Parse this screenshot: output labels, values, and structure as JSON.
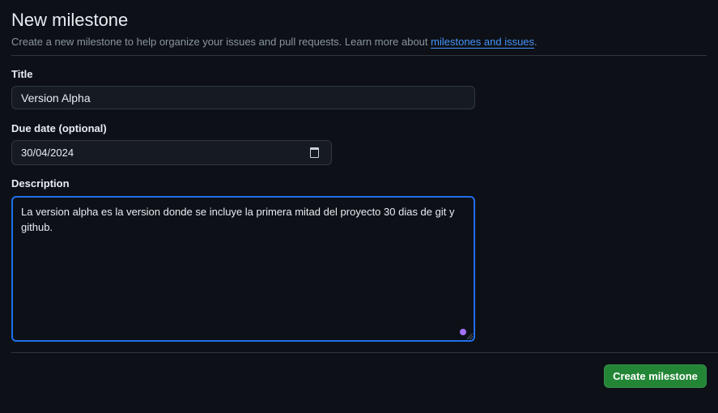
{
  "header": {
    "title": "New milestone",
    "subtitle": "Create a new milestone to help organize your issues and pull requests. Learn more about ",
    "link_text": "milestones and issues",
    "subtitle_end": "."
  },
  "form": {
    "title_label": "Title",
    "title_value": "Version Alpha",
    "due_date_label": "Due date (optional)",
    "due_date_value": "30/04/2024",
    "description_label": "Description",
    "description_value": "La version alpha es la version donde se incluye la primera mitad del proyecto 30 dias de git y github."
  },
  "actions": {
    "create_label": "Create milestone"
  },
  "colors": {
    "background": "#0d1117",
    "accent": "#1f6feb",
    "link": "#4493f8",
    "button": "#238636"
  },
  "icons": [
    "calendar-icon",
    "resize-handle-icon",
    "assistant-dot-icon"
  ]
}
